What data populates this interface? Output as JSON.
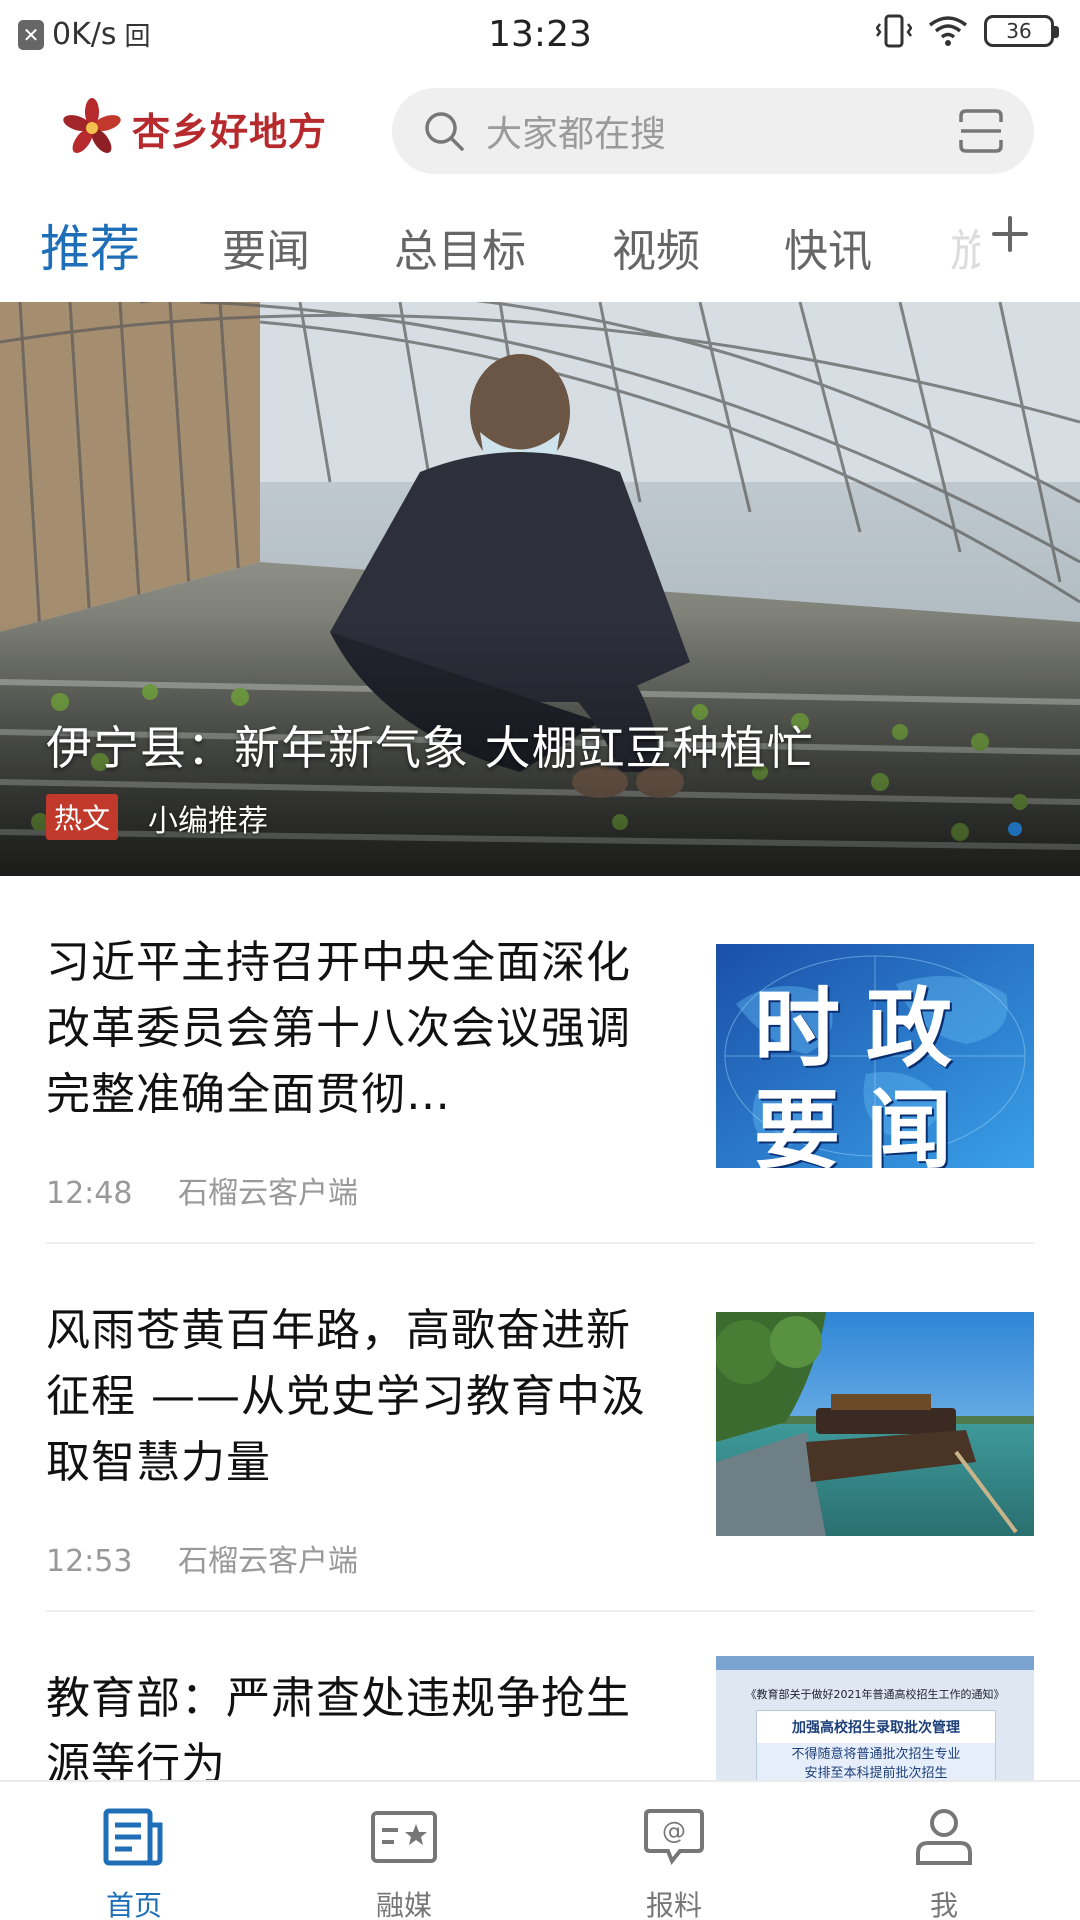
{
  "status_bar": {
    "speed": "0K/s",
    "time": "13:23",
    "battery": "36"
  },
  "header": {
    "logo_text": "杏乡好地方",
    "search_placeholder": "大家都在搜"
  },
  "tabs": [
    {
      "label": "推荐",
      "active": true
    },
    {
      "label": "要闻",
      "active": false
    },
    {
      "label": "总目标",
      "active": false
    },
    {
      "label": "视频",
      "active": false
    },
    {
      "label": "快讯",
      "active": false
    },
    {
      "label": "旅",
      "active": false
    }
  ],
  "hero": {
    "title": "伊宁县：新年新气象 大棚豇豆种植忙",
    "badge": "热文",
    "subtitle": "小编推荐"
  },
  "news": [
    {
      "title": "习近平主持召开中央全面深化改革委员会第十八次会议强调 完整准确全面贯彻…",
      "time": "12:48",
      "source": "石榴云客户端",
      "thumb_text_1": "时政",
      "thumb_text_2": "要闻"
    },
    {
      "title": "风雨苍黄百年路，高歌奋进新征程 ——从党史学习教育中汲取智慧力量",
      "time": "12:53",
      "source": "石榴云客户端"
    },
    {
      "title": "教育部：严肃查处违规争抢生源等行为",
      "doc_title": "《教育部关于做好2021年普通高校招生工作的通知》",
      "doc_line_1": "加强高校招生录取批次管理",
      "doc_line_2": "不得随意将普通批次招生专业",
      "doc_line_3": "安排至本科提前批次招生"
    }
  ],
  "bottom_nav": [
    {
      "label": "首页",
      "icon": "home-news-icon",
      "active": true
    },
    {
      "label": "融媒",
      "icon": "media-card-icon",
      "active": false
    },
    {
      "label": "报料",
      "icon": "report-chat-icon",
      "active": false
    },
    {
      "label": "我",
      "icon": "user-icon",
      "active": false
    }
  ],
  "colors": {
    "accent": "#1f6fb8",
    "brand": "#b6292c",
    "badge": "#c0392b"
  }
}
